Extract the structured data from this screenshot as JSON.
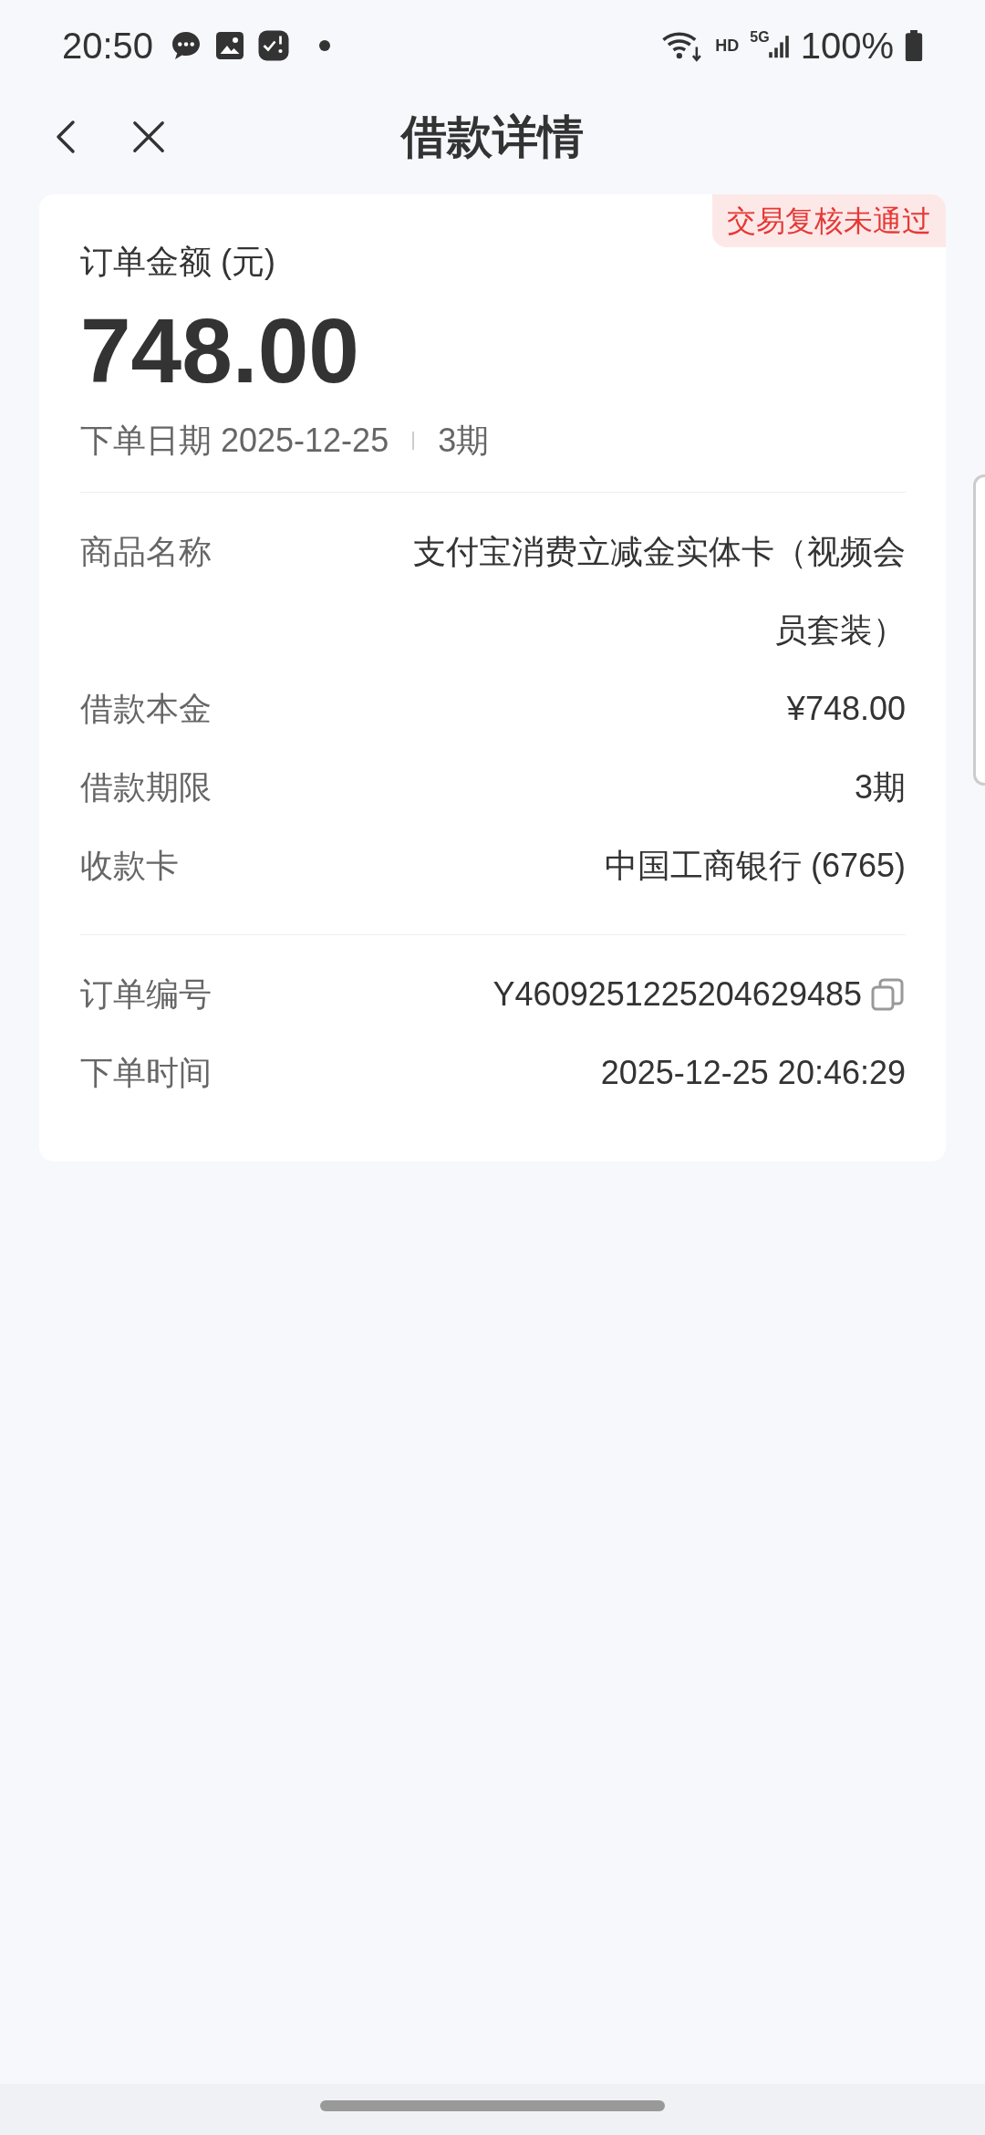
{
  "status_bar": {
    "time": "20:50",
    "network_badge": "HD",
    "network_type": "5G",
    "battery": "100%"
  },
  "header": {
    "title": "借款详情"
  },
  "order": {
    "status_tag": "交易复核未通过",
    "amount_label": "订单金额 (元)",
    "amount": "748.00",
    "date": "下单日期 2025-12-25",
    "term": "3期",
    "details": [
      {
        "label": "商品名称",
        "value": "支付宝消费立减金实体卡（视频会员套装）"
      },
      {
        "label": "借款本金",
        "value": "¥748.00"
      },
      {
        "label": "借款期限",
        "value": "3期"
      },
      {
        "label": "收款卡",
        "value": "中国工商银行 (6765)"
      }
    ],
    "meta": [
      {
        "label": "订单编号",
        "value": "Y4609251225204629485",
        "kind": "copyable"
      },
      {
        "label": "下单时间",
        "value": "2025-12-25 20:46:29",
        "kind": "plain"
      }
    ]
  }
}
